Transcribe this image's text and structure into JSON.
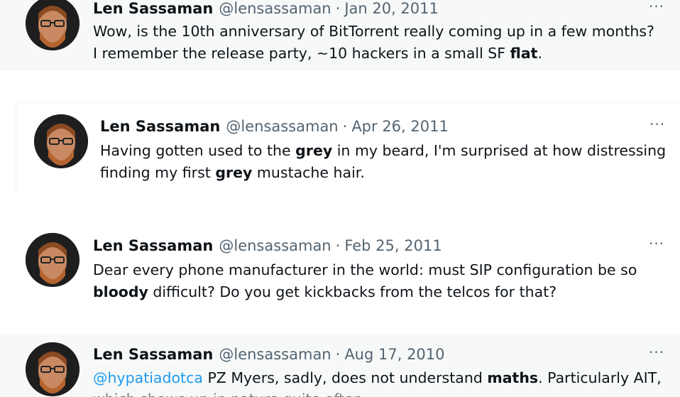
{
  "tweets": [
    {
      "name": "Len Sassaman",
      "handle": "@lensassaman",
      "sep": "·",
      "date": "Jan 20, 2011",
      "more": "···",
      "line1": "Wow, is the 10th anniversary of BitTorrent really coming up in a few months?",
      "line2_pre": "I remember the release party, ~10 hackers in a small SF ",
      "line2_bold": "flat",
      "line2_post": "."
    },
    {
      "name": "Len Sassaman",
      "handle": "@lensassaman",
      "sep": "·",
      "date": "Apr 26, 2011",
      "more": "···",
      "line1_pre": "Having gotten used to the ",
      "line1_bold": "grey",
      "line1_post": " in my beard, I'm surprised at how distressing",
      "line2_pre": "finding my first ",
      "line2_bold": "grey",
      "line2_post": " mustache hair."
    },
    {
      "name": "Len Sassaman",
      "handle": "@lensassaman",
      "sep": "·",
      "date": "Feb 25, 2011",
      "more": "···",
      "line1": "Dear every phone manufacturer in the world: must SIP configuration be so",
      "line2_bold": "bloody",
      "line2_post": " difficult? Do you get kickbacks from the telcos for that?"
    },
    {
      "name": "Len Sassaman",
      "handle": "@lensassaman",
      "sep": "·",
      "date": "Aug 17, 2010",
      "more": "···",
      "mention": "@hypatiadotca",
      "line1_mid": " PZ Myers, sadly, does not understand ",
      "line1_bold": "maths",
      "line1_post": ". Particularly AIT,",
      "line2_partial": "which shows up in nature quite often."
    }
  ]
}
